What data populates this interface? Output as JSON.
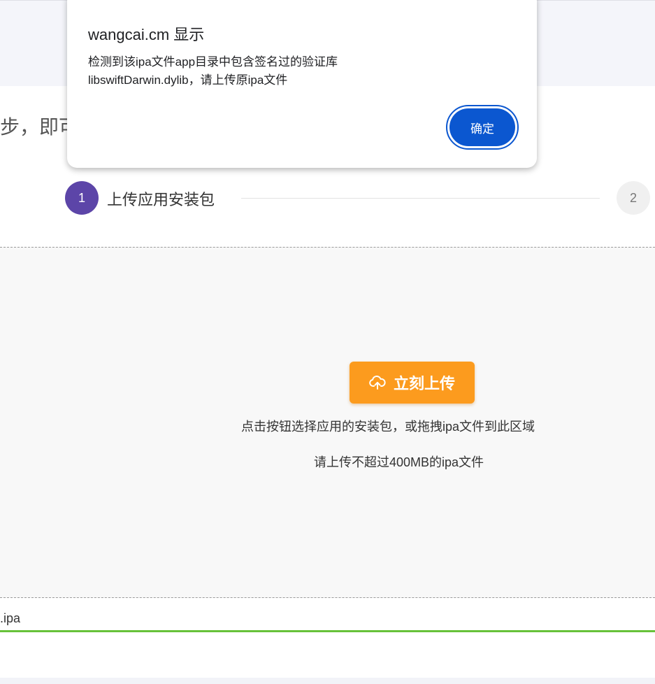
{
  "page": {
    "heading_fragment": "步，即可",
    "steps": [
      {
        "number": "1",
        "label": "上传应用安装包",
        "state": "active"
      },
      {
        "number": "2",
        "state": "pending"
      }
    ],
    "upload": {
      "button_label": "立刻上传",
      "button_icon": "cloud-upload-icon",
      "hint_primary": "点击按钮选择应用的安装包，或拖拽ipa文件到此区域",
      "hint_limit": "请上传不超过400MB的ipa文件"
    },
    "file": {
      "name_fragment": ".ipa",
      "progress": 1.0
    }
  },
  "dialog": {
    "title": "wangcai.cm 显示",
    "message_line_1": "检测到该ipa文件app目录中包含签名过的验证库",
    "message_line_2": "libswiftDarwin.dylib，请上传原ipa文件",
    "ok_label": "确定"
  },
  "colors": {
    "step_active": "#5c45a8",
    "upload_button": "#fc9b1e",
    "progress": "#67c23a",
    "dialog_button": "#0b57d0"
  }
}
